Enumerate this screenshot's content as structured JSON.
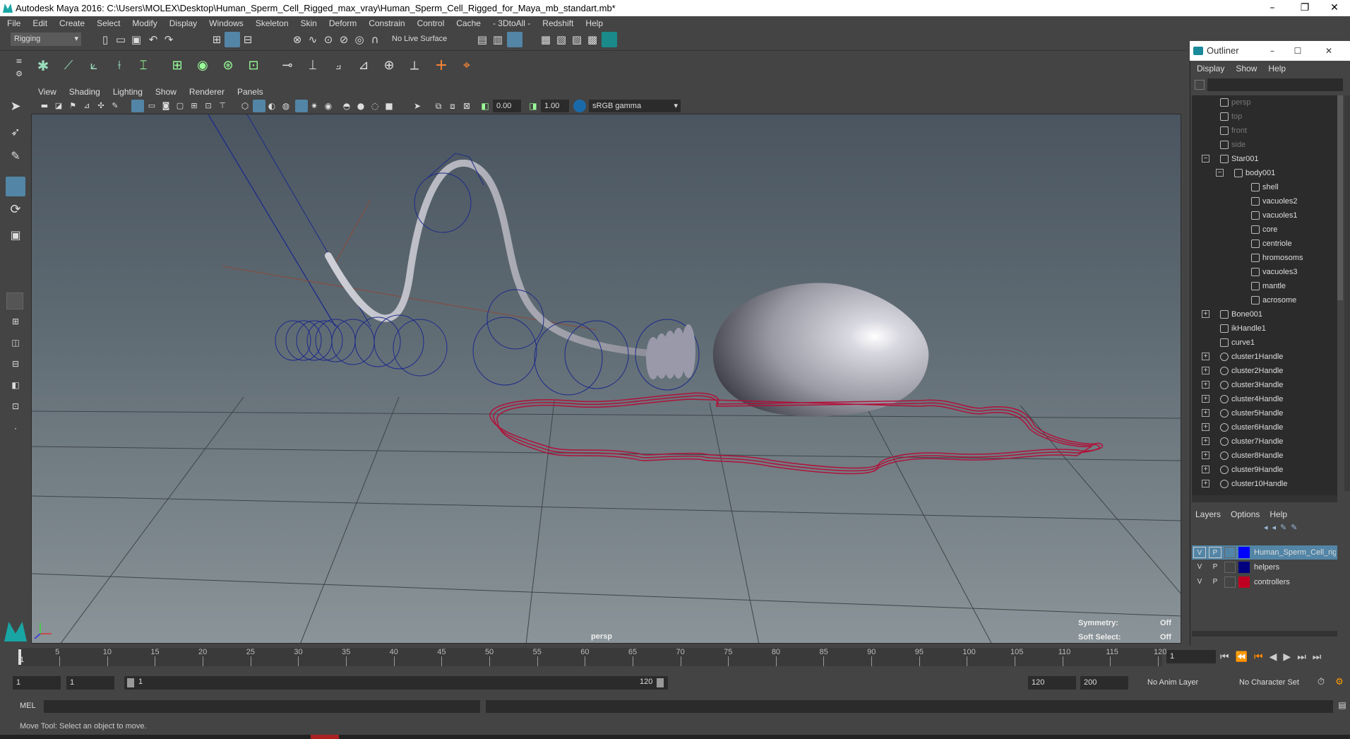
{
  "window": {
    "title": "Autodesk Maya 2016: C:\\Users\\MOLEX\\Desktop\\Human_Sperm_Cell_Rigged_max_vray\\Human_Sperm_Cell_Rigged_for_Maya_mb_standart.mb*",
    "minimize": "–",
    "restore": "❐",
    "close": "✕"
  },
  "menubar": [
    "File",
    "Edit",
    "Create",
    "Select",
    "Modify",
    "Display",
    "Windows",
    "Skeleton",
    "Skin",
    "Deform",
    "Constrain",
    "Control",
    "Cache",
    "- 3DtoAll -",
    "Redshift",
    "Help"
  ],
  "statusline": {
    "mode": "Rigging",
    "live_surface": "No Live Surface"
  },
  "viewport": {
    "menu": [
      "View",
      "Shading",
      "Lighting",
      "Show",
      "Renderer",
      "Panels"
    ],
    "exposure": "0.00",
    "gamma": "1.00",
    "colorspace": "sRGB gamma",
    "camera_label": "persp",
    "symmetry_label": "Symmetry:",
    "symmetry_value": "Off",
    "softselect_label": "Soft Select:",
    "softselect_value": "Off"
  },
  "outliner": {
    "title": "Outliner",
    "menu": [
      "Display",
      "Show",
      "Help"
    ],
    "items": [
      {
        "label": "persp",
        "depth": 0,
        "dim": true,
        "icon": "camera-icon"
      },
      {
        "label": "top",
        "depth": 0,
        "dim": true,
        "icon": "camera-icon"
      },
      {
        "label": "front",
        "depth": 0,
        "dim": true,
        "icon": "camera-icon"
      },
      {
        "label": "side",
        "depth": 0,
        "dim": true,
        "icon": "camera-icon"
      },
      {
        "label": "Star001",
        "depth": 0,
        "expander": "−",
        "icon": "group-icon"
      },
      {
        "label": "body001",
        "depth": 1,
        "expander": "−",
        "icon": "group-icon"
      },
      {
        "label": "shell",
        "depth": 2,
        "icon": "mesh-icon"
      },
      {
        "label": "vacuoles2",
        "depth": 2,
        "icon": "mesh-icon"
      },
      {
        "label": "vacuoles1",
        "depth": 2,
        "icon": "mesh-icon"
      },
      {
        "label": "core",
        "depth": 2,
        "icon": "mesh-icon"
      },
      {
        "label": "centriole",
        "depth": 2,
        "icon": "mesh-icon"
      },
      {
        "label": "hromosoms",
        "depth": 2,
        "icon": "mesh-icon"
      },
      {
        "label": "vacuoles3",
        "depth": 2,
        "icon": "mesh-icon"
      },
      {
        "label": "mantle",
        "depth": 2,
        "icon": "mesh-icon"
      },
      {
        "label": "acrosome",
        "depth": 2,
        "icon": "mesh-icon"
      },
      {
        "label": "Bone001",
        "depth": 0,
        "expander": "+",
        "icon": "joint-icon"
      },
      {
        "label": "ikHandle1",
        "depth": 0,
        "icon": "ik-handle-icon"
      },
      {
        "label": "curve1",
        "depth": 0,
        "icon": "curve-icon"
      },
      {
        "label": "cluster1Handle",
        "depth": 0,
        "expander": "+",
        "icon": "cluster-icon"
      },
      {
        "label": "cluster2Handle",
        "depth": 0,
        "expander": "+",
        "icon": "cluster-icon"
      },
      {
        "label": "cluster3Handle",
        "depth": 0,
        "expander": "+",
        "icon": "cluster-icon"
      },
      {
        "label": "cluster4Handle",
        "depth": 0,
        "expander": "+",
        "icon": "cluster-icon"
      },
      {
        "label": "cluster5Handle",
        "depth": 0,
        "expander": "+",
        "icon": "cluster-icon"
      },
      {
        "label": "cluster6Handle",
        "depth": 0,
        "expander": "+",
        "icon": "cluster-icon"
      },
      {
        "label": "cluster7Handle",
        "depth": 0,
        "expander": "+",
        "icon": "cluster-icon"
      },
      {
        "label": "cluster8Handle",
        "depth": 0,
        "expander": "+",
        "icon": "cluster-icon"
      },
      {
        "label": "cluster9Handle",
        "depth": 0,
        "expander": "+",
        "icon": "cluster-icon"
      },
      {
        "label": "cluster10Handle",
        "depth": 0,
        "expander": "+",
        "icon": "cluster-icon"
      }
    ]
  },
  "layers": {
    "menu": [
      "Layers",
      "Options",
      "Help"
    ],
    "rows": [
      {
        "v": "V",
        "p": "P",
        "name": "Human_Sperm_Cell_rig",
        "color": "#0000ff",
        "selected": true
      },
      {
        "v": "V",
        "p": "P",
        "name": "helpers",
        "color": "#000080",
        "selected": false
      },
      {
        "v": "V",
        "p": "P",
        "name": "controllers",
        "color": "#c00020",
        "selected": false
      }
    ]
  },
  "timeline": {
    "ticks": [
      "5",
      "10",
      "15",
      "20",
      "25",
      "30",
      "35",
      "40",
      "45",
      "50",
      "55",
      "60",
      "65",
      "70",
      "75",
      "80",
      "85",
      "90",
      "95",
      "100",
      "105",
      "110",
      "115",
      "120"
    ],
    "current_frame_marker": "1",
    "current_frame": "1"
  },
  "range": {
    "start": "1",
    "playback_start": "1",
    "slider_start": "1",
    "slider_end": "120",
    "playback_end": "120",
    "end": "200",
    "anim_layer": "No Anim Layer",
    "character_set": "No Character Set"
  },
  "command": {
    "language": "MEL"
  },
  "help_line": "Move Tool: Select an object to move."
}
